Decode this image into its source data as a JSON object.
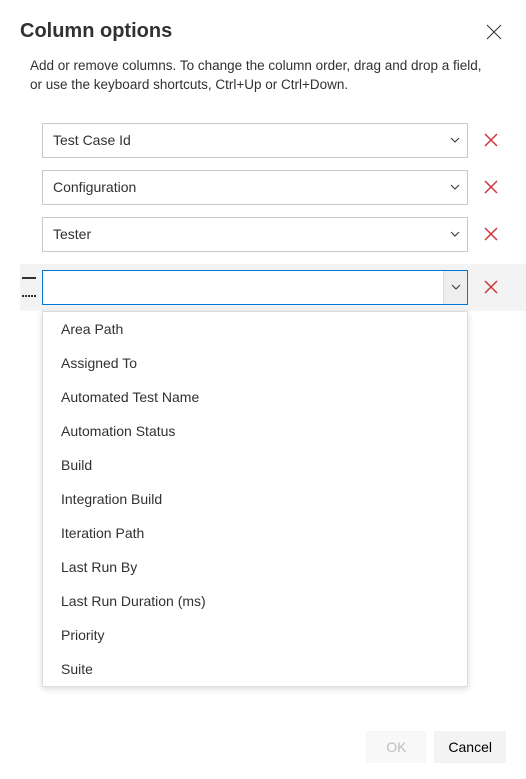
{
  "dialog": {
    "title": "Column options",
    "description": "Add or remove columns. To change the column order, drag and drop a field, or use the keyboard shortcuts, Ctrl+Up or Ctrl+Down."
  },
  "columns": [
    {
      "value": "Test Case Id"
    },
    {
      "value": "Configuration"
    },
    {
      "value": "Tester"
    },
    {
      "value": ""
    }
  ],
  "active_input_placeholder": "",
  "dropdown": {
    "options": [
      "Area Path",
      "Assigned To",
      "Automated Test Name",
      "Automation Status",
      "Build",
      "Integration Build",
      "Iteration Path",
      "Last Run By",
      "Last Run Duration (ms)",
      "Priority",
      "Suite"
    ]
  },
  "footer": {
    "ok": "OK",
    "cancel": "Cancel"
  },
  "colors": {
    "accent": "#0078d4",
    "danger": "#d13438",
    "text": "#323130"
  }
}
